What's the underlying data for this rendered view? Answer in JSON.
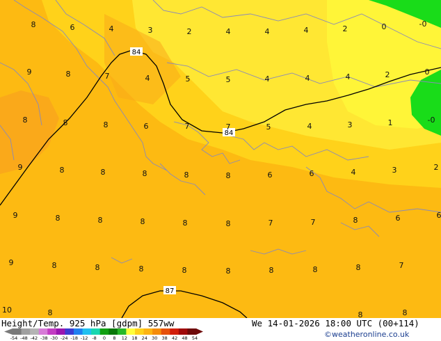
{
  "map": {
    "colors": {
      "base": "#FDBA12",
      "warm_patch": "#FAA91A",
      "mid": "#FFD21A",
      "light": "#FFE733",
      "lightest": "#FFF538",
      "green": "#19DC19",
      "coast": "#8A8AB8",
      "contour": "#000000"
    },
    "values": [
      "8",
      "6",
      "4",
      "3",
      "2",
      "4",
      "4",
      "4",
      "2",
      "0",
      "-0",
      "9",
      "8",
      "7",
      "4",
      "5",
      "5",
      "4",
      "4",
      "4",
      "2",
      "0",
      "8",
      "8",
      "8",
      "6",
      "7",
      "7",
      "5",
      "4",
      "3",
      "1",
      "-0",
      "9",
      "8",
      "8",
      "8",
      "8",
      "8",
      "6",
      "6",
      "4",
      "3",
      "2",
      "9",
      "8",
      "8",
      "8",
      "8",
      "8",
      "7",
      "7",
      "8",
      "6",
      "6",
      "9",
      "8",
      "8",
      "8",
      "8",
      "8",
      "8",
      "8",
      "8",
      "7",
      "10",
      "8",
      "8",
      "8"
    ],
    "contours": [
      "84",
      "84",
      "87"
    ]
  },
  "footer": {
    "title": "Height/Temp. 925 hPa [gdpm] 557ww",
    "datetime": "We 14-01-2026 18:00 UTC (00+114)",
    "credit": "©weatheronline.co.uk",
    "scale_labels": [
      "-54",
      "-48",
      "-42",
      "-38",
      "-30",
      "-24",
      "-18",
      "-12",
      "-8",
      "0",
      "8",
      "12",
      "18",
      "24",
      "30",
      "38",
      "42",
      "48",
      "54"
    ],
    "scale_colors": [
      "#7a7a7a",
      "#a0a0a0",
      "#b4b4b4",
      "#d77bd7",
      "#c23cc2",
      "#9a16b0",
      "#3c3cd2",
      "#2080f0",
      "#20c0f0",
      "#18d7b0",
      "#12a012",
      "#0a780a",
      "#28b828",
      "#ffff3c",
      "#ffd21a",
      "#fdb412",
      "#f58c0a",
      "#e6500a",
      "#d21e0a",
      "#a00a0a",
      "#6e0a0a"
    ]
  }
}
